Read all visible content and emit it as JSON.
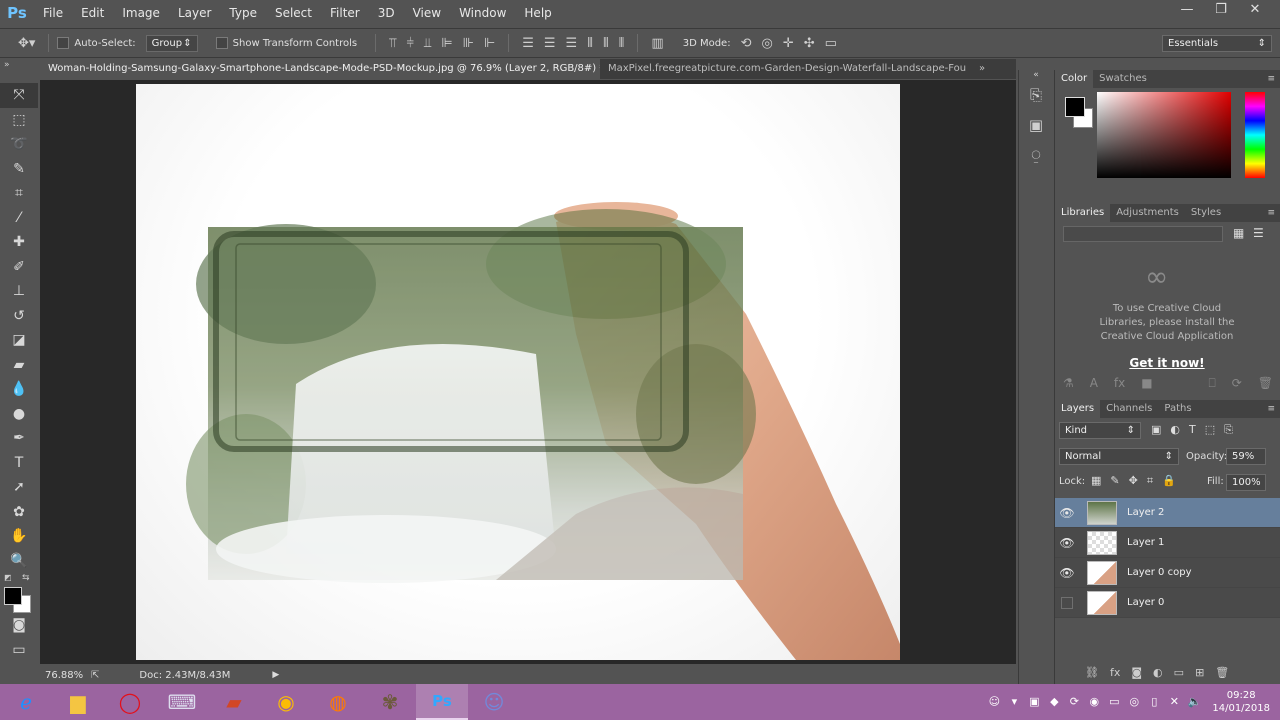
{
  "app": {
    "logo": "Ps",
    "menu": [
      "File",
      "Edit",
      "Image",
      "Layer",
      "Type",
      "Select",
      "Filter",
      "3D",
      "View",
      "Window",
      "Help"
    ],
    "window_controls": {
      "minimize": "—",
      "restore": "❐",
      "close": "✕"
    }
  },
  "options": {
    "auto_select_label": "Auto-Select:",
    "auto_select_value": "Group",
    "show_transform_label": "Show Transform Controls",
    "mode3d_label": "3D Mode:",
    "workspace": "Essentials"
  },
  "tabs": [
    {
      "label": "Woman-Holding-Samsung-Galaxy-Smartphone-Landscape-Mode-PSD-Mockup.jpg @ 76.9% (Layer 2, RGB/8#) *",
      "active": true
    },
    {
      "label": "MaxPixel.freegreatpicture.com-Garden-Design-Waterfall-Landscape-Fou",
      "active": false
    }
  ],
  "tabs_overflow": "»",
  "status": {
    "zoom": "76.88%",
    "doc": "Doc: 2.43M/8.43M"
  },
  "panels": {
    "color_tabs": [
      "Color",
      "Swatches"
    ],
    "lib_tabs": [
      "Libraries",
      "Adjustments",
      "Styles"
    ],
    "cc_message": "To use Creative Cloud Libraries, please install the Creative Cloud Application",
    "cc_link": "Get it now!",
    "layer_tabs": [
      "Layers",
      "Channels",
      "Paths"
    ],
    "kind_label": "Kind",
    "blend_mode": "Normal",
    "opacity_label": "Opacity:",
    "opacity_value": "59%",
    "lock_label": "Lock:",
    "fill_label": "Fill:",
    "fill_value": "100%"
  },
  "layers": [
    {
      "name": "Layer 2",
      "visible": true,
      "selected": true
    },
    {
      "name": "Layer 1",
      "visible": true,
      "selected": false
    },
    {
      "name": "Layer 0 copy",
      "visible": true,
      "selected": false
    },
    {
      "name": "Layer 0",
      "visible": false,
      "selected": false
    }
  ],
  "taskbar": {
    "apps": [
      "ie-icon",
      "explorer-icon",
      "opera-icon",
      "keyboard-icon",
      "powerpoint-icon",
      "chrome-icon",
      "firefox-icon",
      "gimp-icon",
      "photoshop-icon",
      "discord-icon"
    ],
    "time": "09:28",
    "date": "14/01/2018"
  },
  "colors": {
    "selected_layer": "#667f9c",
    "taskbar": "#9b64a0",
    "ps_blue": "#6fc4ff"
  }
}
